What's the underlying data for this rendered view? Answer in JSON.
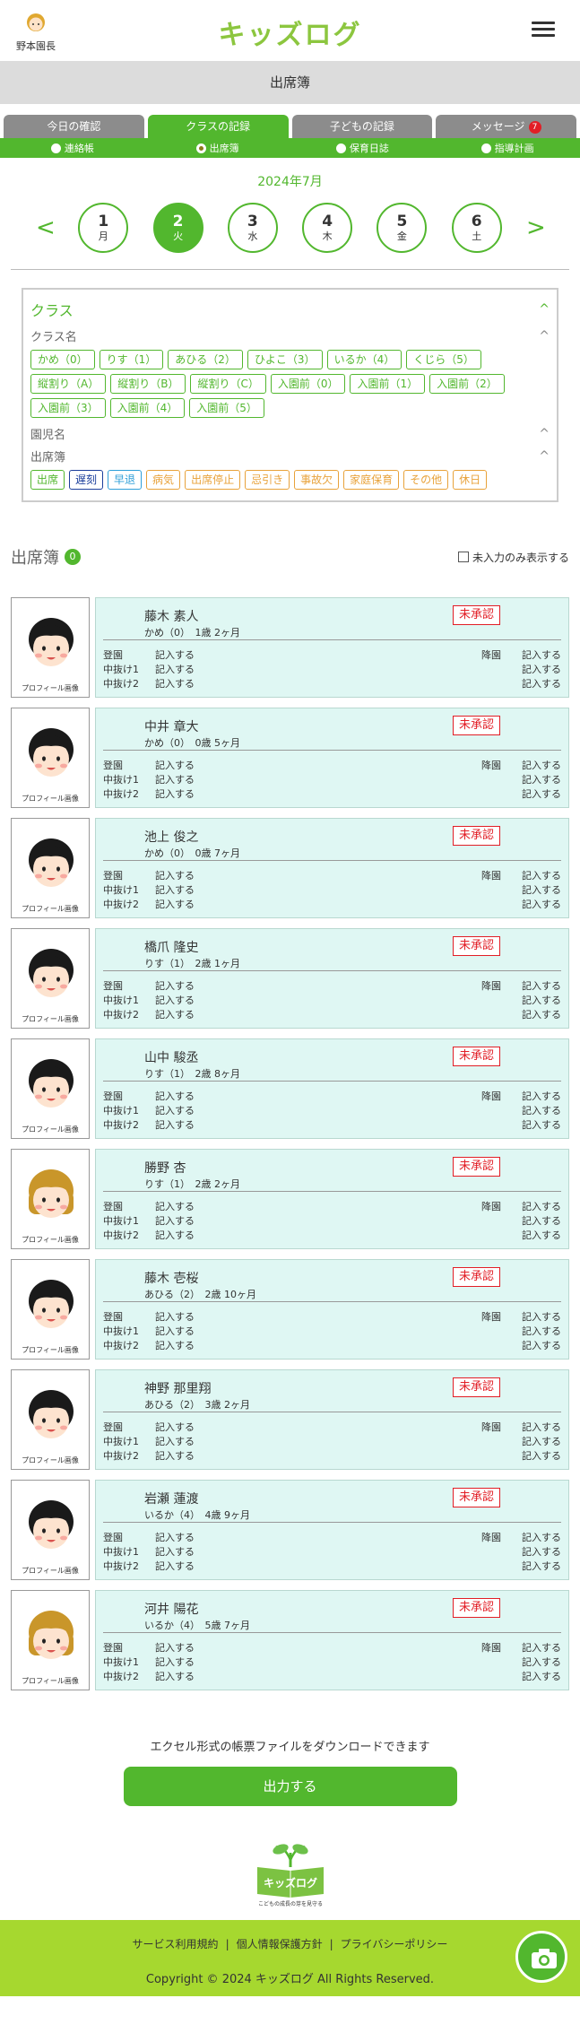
{
  "header": {
    "user_name": "野本園長",
    "app_title": "キッズログ"
  },
  "page_title": "出席簿",
  "tabs": [
    {
      "label": "今日の確認"
    },
    {
      "label": "クラスの記録"
    },
    {
      "label": "子どもの記録"
    },
    {
      "label": "メッセージ",
      "badge": "7"
    }
  ],
  "subtabs": [
    {
      "label": "連絡帳"
    },
    {
      "label": "出席簿"
    },
    {
      "label": "保育日誌"
    },
    {
      "label": "指導計画"
    }
  ],
  "date": {
    "month": "2024年7月",
    "prev": "<",
    "next": ">",
    "days": [
      {
        "num": "1",
        "wd": "月"
      },
      {
        "num": "2",
        "wd": "火"
      },
      {
        "num": "3",
        "wd": "水"
      },
      {
        "num": "4",
        "wd": "木"
      },
      {
        "num": "5",
        "wd": "金"
      },
      {
        "num": "6",
        "wd": "土"
      }
    ]
  },
  "filter": {
    "title": "クラス",
    "class_label": "クラス名",
    "classes": [
      "かめ（0）",
      "りす（1）",
      "あひる（2）",
      "ひよこ（3）",
      "いるか（4）",
      "くじら（5）",
      "縦割り（A）",
      "縦割り（B）",
      "縦割り（C）",
      "入園前（0）",
      "入園前（1）",
      "入園前（2）",
      "入園前（3）",
      "入園前（4）",
      "入園前（5）"
    ],
    "child_label": "園児名",
    "attendance_label": "出席簿",
    "attendance": [
      {
        "label": "出席",
        "color": "#52b72e"
      },
      {
        "label": "遅刻",
        "color": "#1c3f9c"
      },
      {
        "label": "早退",
        "color": "#2f9fd8"
      },
      {
        "label": "病気",
        "color": "#e8a23a"
      },
      {
        "label": "出席停止",
        "color": "#e8a23a"
      },
      {
        "label": "忌引き",
        "color": "#e8a23a"
      },
      {
        "label": "事故欠",
        "color": "#e8a23a"
      },
      {
        "label": "家庭保育",
        "color": "#e8a23a"
      },
      {
        "label": "その他",
        "color": "#e8a23a"
      },
      {
        "label": "休日",
        "color": "#e8a23a"
      }
    ]
  },
  "list": {
    "title": "出席簿",
    "count": "0",
    "unentered_only": "未入力のみ表示する"
  },
  "row_labels": {
    "arrive": "登園",
    "leave": "降園",
    "out1": "中抜け1",
    "out2": "中抜け2",
    "enter": "記入する",
    "photo_caption": "プロフィール画像"
  },
  "children": [
    {
      "name": "藤木 素人",
      "klass": "かめ（0）　1歳 2ヶ月",
      "status": "未承認",
      "hair": "black"
    },
    {
      "name": "中井 章大",
      "klass": "かめ（0）　0歳 5ヶ月",
      "status": "未承認",
      "hair": "black"
    },
    {
      "name": "池上 俊之",
      "klass": "かめ（0）　0歳 7ヶ月",
      "status": "未承認",
      "hair": "black"
    },
    {
      "name": "橋爪 隆史",
      "klass": "りす（1）　2歳 1ヶ月",
      "status": "未承認",
      "hair": "black"
    },
    {
      "name": "山中 駿丞",
      "klass": "りす（1）　2歳 8ヶ月",
      "status": "未承認",
      "hair": "black"
    },
    {
      "name": "勝野 杏",
      "klass": "りす（1）　2歳 2ヶ月",
      "status": "未承認",
      "hair": "blonde"
    },
    {
      "name": "藤木 壱桜",
      "klass": "あひる（2）　2歳 10ヶ月",
      "status": "未承認",
      "hair": "black"
    },
    {
      "name": "神野 那里翔",
      "klass": "あひる（2）　3歳 2ヶ月",
      "status": "未承認",
      "hair": "black"
    },
    {
      "name": "岩瀬 蓮渡",
      "klass": "いるか（4）　4歳 9ヶ月",
      "status": "未承認",
      "hair": "black"
    },
    {
      "name": "河井 陽花",
      "klass": "いるか（4）　5歳 7ヶ月",
      "status": "未承認",
      "hair": "blonde"
    }
  ],
  "download": {
    "text": "エクセル形式の帳票ファイルをダウンロードできます",
    "button": "出力する"
  },
  "footer_logo": {
    "name": "キッズログ",
    "tagline": "こどもの成長の芽を見守る"
  },
  "footer": {
    "terms": "サービス利用規約",
    "privacy_info": "個人情報保護方針",
    "privacy_policy": "プライバシーポリシー",
    "sep": "|",
    "copyright": "Copyright © 2024 キッズログ All Rights Reserved."
  },
  "colors": {
    "brand": "#52b72e",
    "logo": "#8cc63f",
    "alert": "#e21e26",
    "card_bg": "#dff7f3",
    "footer_bg": "#a6d82f"
  }
}
